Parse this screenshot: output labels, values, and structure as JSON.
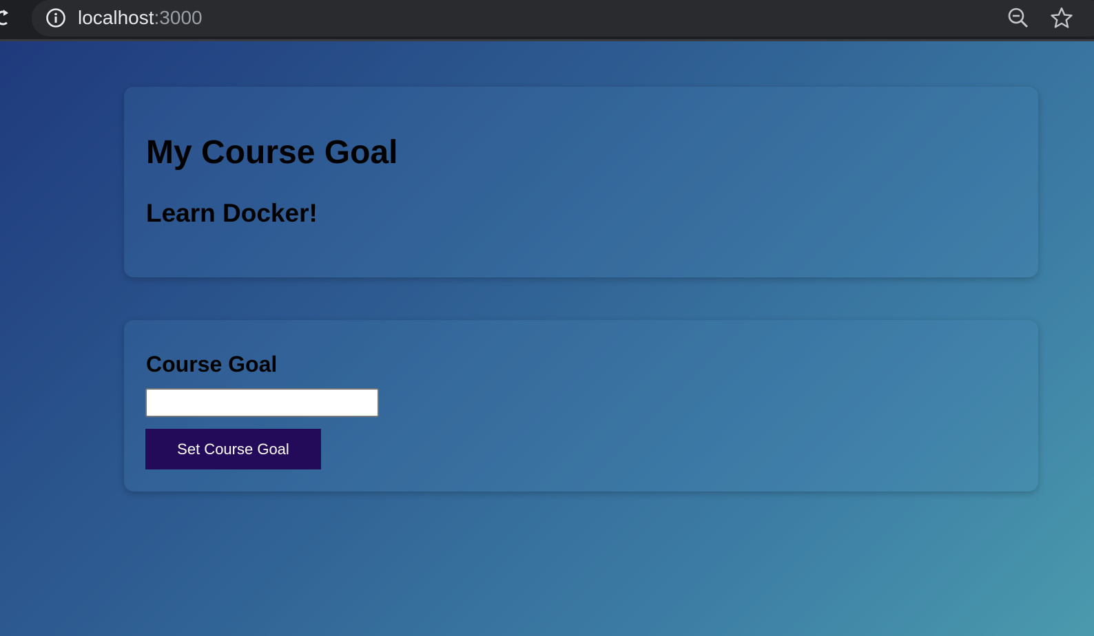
{
  "browser": {
    "url_host": "localhost",
    "url_port": ":3000",
    "icons": [
      "reload-icon",
      "info-icon",
      "zoom-out-icon",
      "star-icon"
    ]
  },
  "goal_card": {
    "title": "My Course Goal",
    "goal_text": "Learn Docker!"
  },
  "form": {
    "label": "Course Goal",
    "input_value": "",
    "input_placeholder": "",
    "button_label": "Set Course Goal"
  },
  "colors": {
    "button_bg": "#240b5a",
    "gradient_start": "#1f3a7c",
    "gradient_end": "#4a9aad"
  }
}
